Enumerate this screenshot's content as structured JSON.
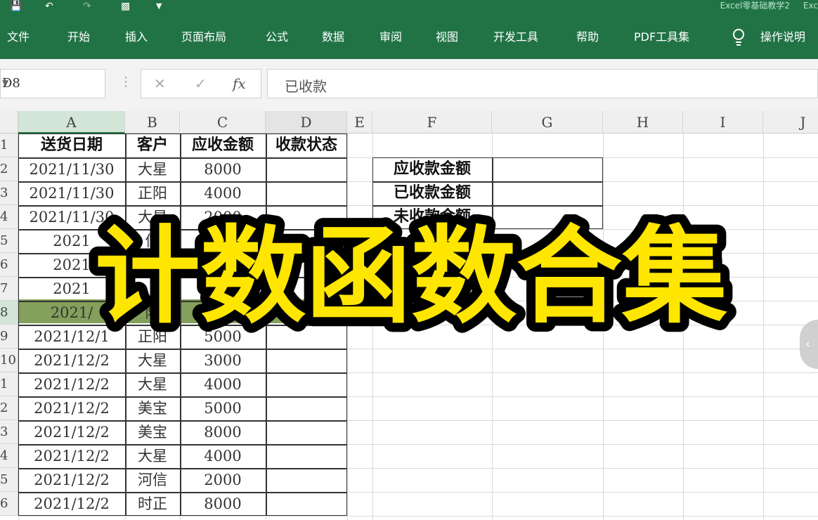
{
  "window": {
    "title": "Excel零基础教学2",
    "title_suffix": "Exc"
  },
  "ribbon": {
    "tabs": [
      "文件",
      "开始",
      "插入",
      "页面布局",
      "公式",
      "数据",
      "审阅",
      "视图",
      "开发工具",
      "帮助",
      "PDF工具集",
      "操作说明"
    ]
  },
  "formula_bar": {
    "name_box": "D8",
    "cancel_symbol": "✕",
    "enter_symbol": "✓",
    "fx_symbol": "fx",
    "content": "已收款"
  },
  "grid": {
    "columns": [
      "A",
      "B",
      "C",
      "D",
      "E",
      "F",
      "G",
      "H",
      "I",
      "J"
    ],
    "row_numbers": [
      "1",
      "2",
      "3",
      "4",
      "5",
      "6",
      "7",
      "8",
      "9",
      "10",
      "1",
      "2",
      "3",
      "4",
      "5",
      "6"
    ],
    "headers": [
      "送货日期",
      "客户",
      "应收金额",
      "收款状态"
    ],
    "rows": [
      [
        "2021/11/30",
        "大星",
        "8000",
        ""
      ],
      [
        "2021/11/30",
        "正阳",
        "4000",
        ""
      ],
      [
        "2021/11/30",
        "大星",
        "2000",
        ""
      ],
      [
        "2021",
        "信",
        "",
        ""
      ],
      [
        "2021",
        "",
        "",
        ""
      ],
      [
        "2021",
        "",
        "",
        ""
      ],
      [
        "2021/",
        "阳",
        "",
        ""
      ],
      [
        "2021/12/1",
        "正阳",
        "5000",
        ""
      ],
      [
        "2021/12/2",
        "大星",
        "3000",
        ""
      ],
      [
        "2021/12/2",
        "大星",
        "4000",
        ""
      ],
      [
        "2021/12/2",
        "美宝",
        "5000",
        ""
      ],
      [
        "2021/12/2",
        "美宝",
        "8000",
        ""
      ],
      [
        "2021/12/2",
        "大星",
        "4000",
        ""
      ],
      [
        "2021/12/2",
        "河信",
        "2000",
        ""
      ],
      [
        "2021/12/2",
        "时正",
        "8000",
        ""
      ]
    ],
    "summary": {
      "labels": [
        "应收款金额",
        "已收款金额",
        "未收款金额"
      ],
      "values": [
        "",
        "",
        ""
      ]
    }
  },
  "overlay": {
    "title": "计数函数合集",
    "fill_color": "#FFE600",
    "stroke_color": "#000000"
  },
  "colors": {
    "ribbon": "#217346",
    "selected_row": "#6f8f3f"
  }
}
